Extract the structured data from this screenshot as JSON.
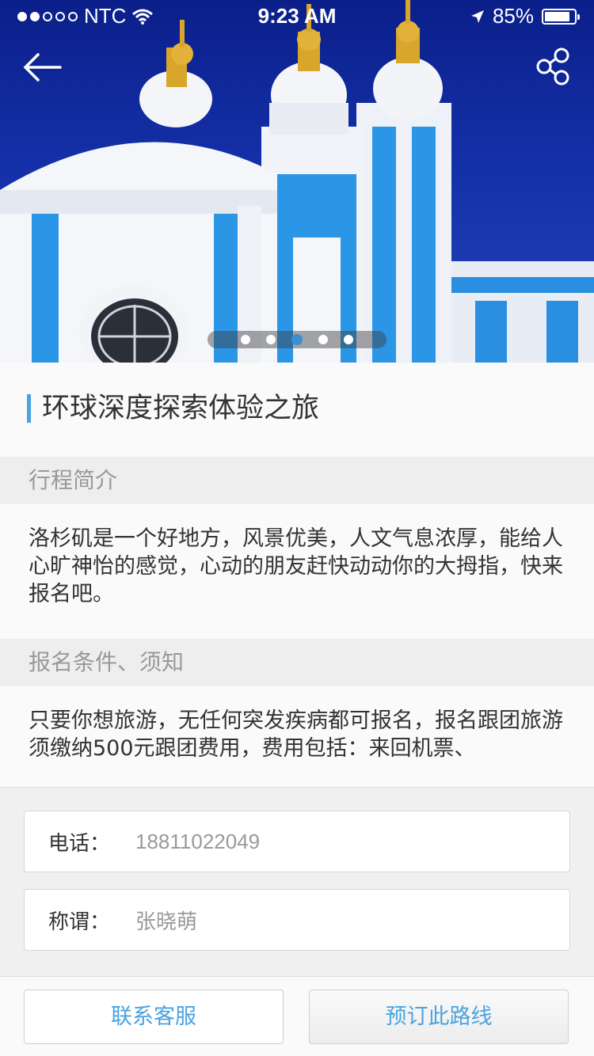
{
  "status_bar": {
    "carrier": "NTC",
    "time": "9:23 AM",
    "battery_percent": "85%",
    "battery_level": 0.85,
    "signal_bars_filled": 2,
    "signal_bars_total": 5
  },
  "hero": {
    "image_subject": "baroque cathedral with blue and white facade and golden domes",
    "back_icon": "arrow-left-icon",
    "share_icon": "share-icon",
    "pager": {
      "count": 5,
      "active_index": 2
    }
  },
  "trip": {
    "title": "环球深度探索体验之旅"
  },
  "sections": {
    "intro": {
      "heading": "行程简介",
      "text": "洛杉矶是一个好地方，风景优美，人文气息浓厚，能给人心旷神怡的感觉，心动的朋友赶快动动你的大拇指，快来报名吧。"
    },
    "conditions": {
      "heading": "报名条件、须知",
      "text": "只要你想旅游，无任何突发疾病都可报名，报名跟团旅游须缴纳500元跟团费用，费用包括：来回机票、"
    }
  },
  "form": {
    "phone_label": "电话：",
    "phone_value": "18811022049",
    "name_label": "称谓：",
    "name_value": "张晓萌"
  },
  "footer": {
    "contact_label": "联系客服",
    "book_label": "预订此路线"
  },
  "colors": {
    "accent": "#4aa3df",
    "sky": "#1430a8"
  }
}
